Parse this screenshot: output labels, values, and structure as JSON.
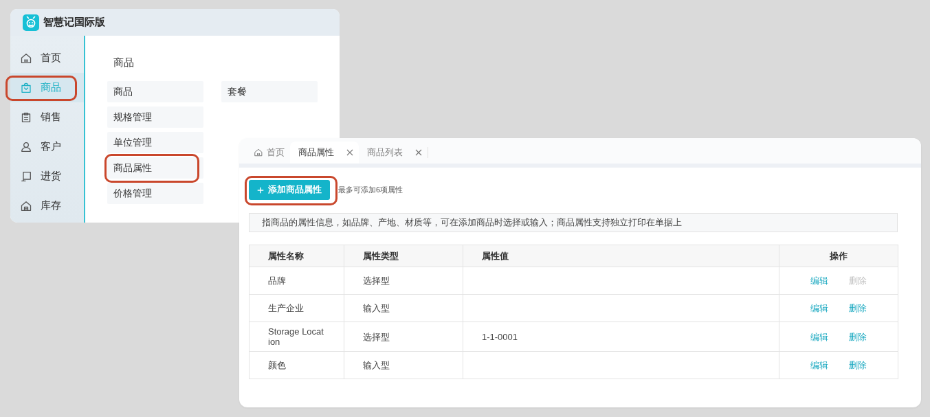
{
  "back_window": {
    "title": "智慧记国际版",
    "sidebar": {
      "items": [
        {
          "label": "首页",
          "selected": false,
          "highlighted": false
        },
        {
          "label": "商品",
          "selected": true,
          "highlighted": true
        },
        {
          "label": "销售",
          "selected": false,
          "highlighted": false
        },
        {
          "label": "客户",
          "selected": false,
          "highlighted": false
        },
        {
          "label": "进货",
          "selected": false,
          "highlighted": false
        },
        {
          "label": "库存",
          "selected": false,
          "highlighted": false
        }
      ]
    },
    "menu": {
      "heading": "商品",
      "columns": [
        {
          "items": [
            {
              "label": "商品",
              "highlighted": false
            },
            {
              "label": "规格管理",
              "highlighted": false
            },
            {
              "label": "单位管理",
              "highlighted": false
            },
            {
              "label": "商品属性",
              "highlighted": true
            },
            {
              "label": "价格管理",
              "highlighted": false
            }
          ]
        },
        {
          "items": [
            {
              "label": "套餐",
              "highlighted": false
            }
          ]
        }
      ]
    }
  },
  "front_window": {
    "tabs": [
      {
        "kind": "home",
        "label": "首页",
        "selected": false
      },
      {
        "kind": "page",
        "label": "商品属性",
        "selected": true
      },
      {
        "kind": "page",
        "label": "商品列表",
        "selected": false
      }
    ],
    "add_button": {
      "label": "添加商品属性",
      "highlighted": true
    },
    "limit_note": "最多可添加6项属性",
    "info": "指商品的属性信息，如品牌、产地、材质等，可在添加商品时选择或输入；商品属性支持独立打印在单据上",
    "table": {
      "columns": [
        "属性名称",
        "属性类型",
        "属性值",
        "操作"
      ],
      "rows": [
        {
          "name": "品牌",
          "type": "选择型",
          "actions": [
            {
              "label": "编辑",
              "disabled": false
            },
            {
              "label": "删除",
              "disabled": true
            }
          ]
        },
        {
          "name": "生产企业",
          "type": "输入型",
          "actions": [
            {
              "label": "编辑",
              "disabled": false
            },
            {
              "label": "删除",
              "disabled": false
            }
          ]
        },
        {
          "name": "Storage Location",
          "type": "选择型",
          "value": "1-1-0001",
          "actions": [
            {
              "label": "编辑",
              "disabled": false
            },
            {
              "label": "删除",
              "disabled": false
            }
          ]
        },
        {
          "name": "颜色",
          "type": "输入型",
          "actions": [
            {
              "label": "编辑",
              "disabled": false
            },
            {
              "label": "删除",
              "disabled": false
            }
          ]
        }
      ]
    }
  }
}
